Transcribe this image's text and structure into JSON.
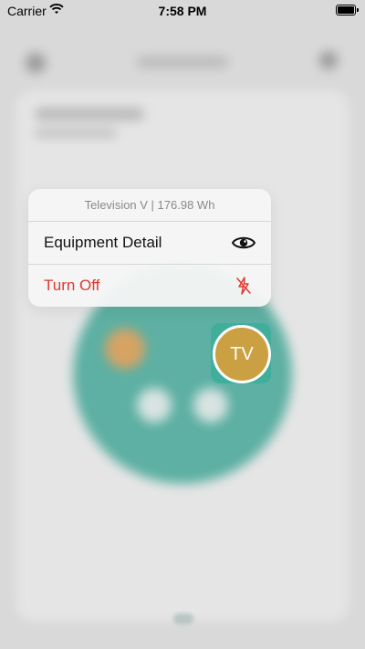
{
  "status_bar": {
    "carrier": "Carrier",
    "time": "7:58 PM"
  },
  "context_menu": {
    "header": "Television V | 176.98 Wh",
    "items": [
      {
        "label": "Equipment Detail",
        "icon": "eye-icon",
        "style": "default"
      },
      {
        "label": "Turn Off",
        "icon": "power-off-icon",
        "style": "destructive",
        "color": "#e0392f"
      }
    ]
  },
  "device_bubble": {
    "label": "TV",
    "circle_color": "#caa042",
    "background_color": "#3fae9a"
  }
}
